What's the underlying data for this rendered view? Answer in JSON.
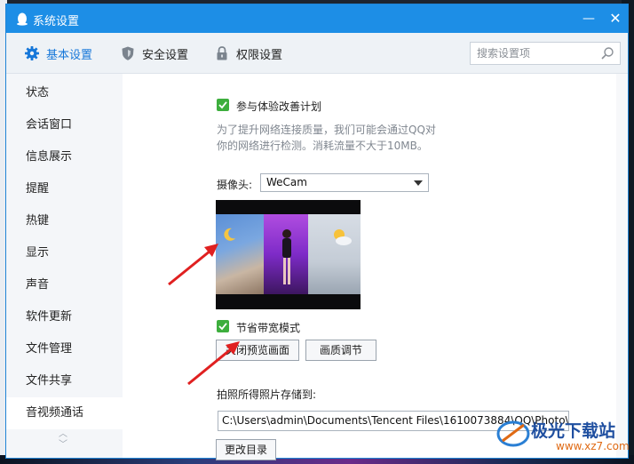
{
  "window": {
    "title": "系统设置",
    "minimize_label": "—",
    "close_label": "✕"
  },
  "tabs": [
    {
      "label": "基本设置",
      "icon": "gear-icon",
      "active": true
    },
    {
      "label": "安全设置",
      "icon": "shield-icon",
      "active": false
    },
    {
      "label": "权限设置",
      "icon": "lock-icon",
      "active": false
    }
  ],
  "search": {
    "placeholder": "搜索设置项"
  },
  "sidebar": {
    "items": [
      {
        "label": "状态"
      },
      {
        "label": "会话窗口"
      },
      {
        "label": "信息展示"
      },
      {
        "label": "提醒"
      },
      {
        "label": "热键"
      },
      {
        "label": "显示"
      },
      {
        "label": "声音"
      },
      {
        "label": "软件更新"
      },
      {
        "label": "文件管理"
      },
      {
        "label": "文件共享"
      },
      {
        "label": "音视频通话"
      }
    ],
    "active_index": 10
  },
  "content": {
    "experience_plan": {
      "label": "参与体验改善计划",
      "checked": true,
      "desc_line1": "为了提升网络连接质量，我们可能会通过QQ对",
      "desc_line2": "你的网络进行检测。消耗流量不大于10MB。"
    },
    "camera": {
      "label": "摄像头:",
      "selected": "WeCam"
    },
    "bandwidth_saving": {
      "label": "节省带宽模式",
      "checked": true
    },
    "buttons": {
      "close_preview": "关闭预览画面",
      "quality_adjust": "画质调节"
    },
    "photo_storage": {
      "label": "拍照所得照片存储到:",
      "path": "C:\\Users\\admin\\Documents\\Tencent Files\\1610073884\\QQ\\Photo\\",
      "change_dir": "更改目录"
    }
  },
  "watermark": {
    "name": "极光下载站",
    "url": "www.xz7.com"
  },
  "colors": {
    "titlebar": "#1d8ee6",
    "accent": "#1677d9",
    "checkbox": "#3dae3d",
    "annotation_arrow": "#e02020"
  }
}
